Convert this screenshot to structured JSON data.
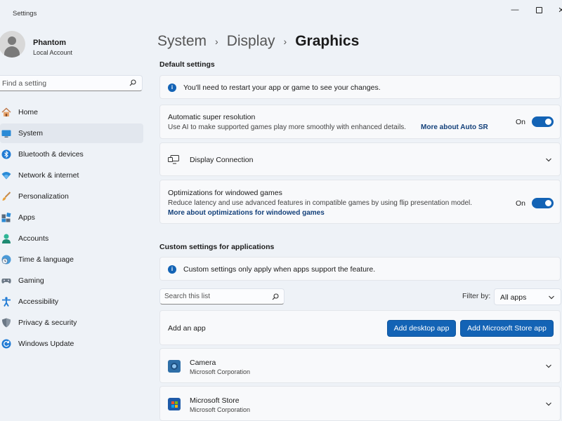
{
  "window": {
    "title": "Settings",
    "minimize_glyph": "—",
    "close_glyph": "✕"
  },
  "profile": {
    "name": "Phantom",
    "subtitle": "Local Account"
  },
  "search": {
    "placeholder": "Find a setting"
  },
  "sidebar": {
    "items": [
      {
        "label": "Home",
        "icon": "home-icon"
      },
      {
        "label": "System",
        "icon": "system-icon",
        "active": true
      },
      {
        "label": "Bluetooth & devices",
        "icon": "bluetooth-icon"
      },
      {
        "label": "Network & internet",
        "icon": "wifi-icon"
      },
      {
        "label": "Personalization",
        "icon": "brush-icon"
      },
      {
        "label": "Apps",
        "icon": "apps-icon"
      },
      {
        "label": "Accounts",
        "icon": "accounts-icon"
      },
      {
        "label": "Time & language",
        "icon": "clock-globe-icon"
      },
      {
        "label": "Gaming",
        "icon": "gamepad-icon"
      },
      {
        "label": "Accessibility",
        "icon": "accessibility-icon"
      },
      {
        "label": "Privacy & security",
        "icon": "shield-icon"
      },
      {
        "label": "Windows Update",
        "icon": "update-icon"
      }
    ]
  },
  "breadcrumb": {
    "part1": "System",
    "part2": "Display",
    "current": "Graphics",
    "separator": "›"
  },
  "default_settings": {
    "title": "Default settings",
    "info_text": "You'll need to restart your app or game to see your changes.",
    "auto_sr": {
      "title": "Automatic super resolution",
      "description": "Use AI to make supported games play more smoothly with enhanced details.",
      "link": "More about Auto SR",
      "state": "On"
    },
    "display_connection": {
      "title": "Display Connection"
    },
    "windowed_games": {
      "title": "Optimizations for windowed games",
      "description": "Reduce latency and use advanced features in compatible games by using flip presentation model.",
      "link": "More about optimizations for windowed games",
      "state": "On"
    }
  },
  "custom_settings": {
    "title": "Custom settings for applications",
    "info_text": "Custom settings only apply when apps support the feature.",
    "list_search_placeholder": "Search this list",
    "filter_label": "Filter by:",
    "filter_value": "All apps",
    "add_app_label": "Add an app",
    "add_desktop_button": "Add desktop app",
    "add_store_button": "Add Microsoft Store app",
    "apps": [
      {
        "name": "Camera",
        "publisher": "Microsoft Corporation",
        "icon": "camera-app-icon"
      },
      {
        "name": "Microsoft Store",
        "publisher": "Microsoft Corporation",
        "icon": "store-app-icon"
      }
    ]
  },
  "colors": {
    "accent": "#1363b5",
    "link": "#13407a",
    "background": "#eef2f7",
    "card": "#f8f9fb"
  }
}
